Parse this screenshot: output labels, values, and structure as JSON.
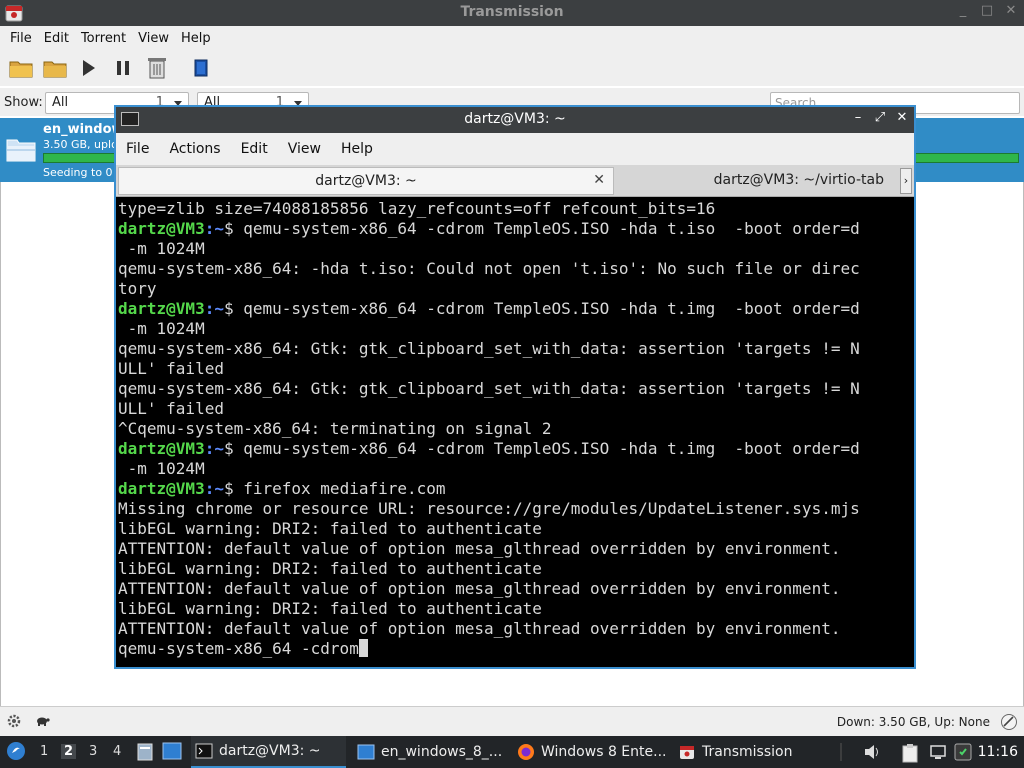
{
  "transmission": {
    "title": "Transmission",
    "window_buttons": [
      "_",
      "□",
      "✕"
    ],
    "menu": [
      "File",
      "Edit",
      "Torrent",
      "View",
      "Help"
    ],
    "toolbar_icons": [
      "open-folder-icon",
      "open-url-icon",
      "start-icon",
      "pause-icon",
      "remove-icon",
      "properties-icon"
    ],
    "filter": {
      "show_label": "Show:",
      "activity": {
        "value": "All",
        "count": "1"
      },
      "tracker": {
        "value": "All",
        "count": "1"
      },
      "search_placeholder": "Search"
    },
    "torrent": {
      "name": "en_window",
      "size_line": "3.50 GB, uplo",
      "progress": 1.0,
      "status": "Seeding to 0"
    },
    "statusbar": {
      "speed": "Down: 3.50 GB, Up: None"
    }
  },
  "terminal": {
    "title": "dartz@VM3: ~",
    "window_buttons": [
      "–",
      "⤢",
      "✕"
    ],
    "menu": [
      "File",
      "Actions",
      "Edit",
      "View",
      "Help"
    ],
    "tabs": [
      {
        "label": "dartz@VM3: ~",
        "close": "✕"
      },
      {
        "label": "dartz@VM3: ~/virtio-tab"
      }
    ],
    "tab_scroll": "›",
    "prompt_user": "dartz@VM3",
    "prompt_path": ":~",
    "prompt_sym": "$ ",
    "lines": [
      {
        "type": "out",
        "text": "type=zlib size=74088185856 lazy_refcounts=off refcount_bits=16"
      },
      {
        "type": "cmd",
        "text": "qemu-system-x86_64 -cdrom TempleOS.ISO -hda t.iso  -boot order=d"
      },
      {
        "type": "out",
        "text": " -m 1024M"
      },
      {
        "type": "out",
        "text": "qemu-system-x86_64: -hda t.iso: Could not open 't.iso': No such file or direc"
      },
      {
        "type": "out",
        "text": "tory"
      },
      {
        "type": "cmd",
        "text": "qemu-system-x86_64 -cdrom TempleOS.ISO -hda t.img  -boot order=d"
      },
      {
        "type": "out",
        "text": " -m 1024M"
      },
      {
        "type": "out",
        "text": "qemu-system-x86_64: Gtk: gtk_clipboard_set_with_data: assertion 'targets != N"
      },
      {
        "type": "out",
        "text": "ULL' failed"
      },
      {
        "type": "out",
        "text": "qemu-system-x86_64: Gtk: gtk_clipboard_set_with_data: assertion 'targets != N"
      },
      {
        "type": "out",
        "text": "ULL' failed"
      },
      {
        "type": "out",
        "text": "^Cqemu-system-x86_64: terminating on signal 2"
      },
      {
        "type": "cmd",
        "text": "qemu-system-x86_64 -cdrom TempleOS.ISO -hda t.img  -boot order=d"
      },
      {
        "type": "out",
        "text": " -m 1024M"
      },
      {
        "type": "cmd",
        "text": "firefox mediafire.com"
      },
      {
        "type": "out",
        "text": "Missing chrome or resource URL: resource://gre/modules/UpdateListener.sys.mjs"
      },
      {
        "type": "out",
        "text": "libEGL warning: DRI2: failed to authenticate"
      },
      {
        "type": "out",
        "text": "ATTENTION: default value of option mesa_glthread overridden by environment."
      },
      {
        "type": "out",
        "text": "libEGL warning: DRI2: failed to authenticate"
      },
      {
        "type": "out",
        "text": "ATTENTION: default value of option mesa_glthread overridden by environment."
      },
      {
        "type": "out",
        "text": "libEGL warning: DRI2: failed to authenticate"
      },
      {
        "type": "out",
        "text": "ATTENTION: default value of option mesa_glthread overridden by environment."
      },
      {
        "type": "input",
        "text": "qemu-system-x86_64 -cdrom"
      }
    ]
  },
  "taskbar": {
    "workspaces": [
      "1",
      "2",
      "3",
      "4"
    ],
    "active_workspace": "2",
    "tasks": [
      {
        "label": "dartz@VM3: ~",
        "icon": "terminal-icon"
      },
      {
        "label": "en_windows_8_...",
        "icon": "folder-icon"
      },
      {
        "label": "Windows 8 Ente...",
        "icon": "firefox-icon"
      },
      {
        "label": "Transmission",
        "icon": "transmission-icon"
      }
    ],
    "clock": "11:16"
  },
  "colors": {
    "selection_blue": "#308cc6",
    "progress_green": "#2fb64a",
    "prompt_green": "#55d84b",
    "prompt_blue": "#5e8cff",
    "terminal_bg": "#000000",
    "focus_border": "#3a8fd0"
  }
}
